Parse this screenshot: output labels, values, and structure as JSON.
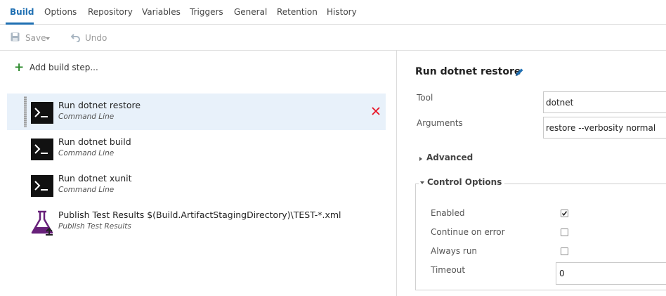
{
  "tabs": [
    {
      "label": "Build",
      "active": true
    },
    {
      "label": "Options"
    },
    {
      "label": "Repository"
    },
    {
      "label": "Variables"
    },
    {
      "label": "Triggers"
    },
    {
      "label": "General"
    },
    {
      "label": "Retention"
    },
    {
      "label": "History"
    }
  ],
  "toolbar": {
    "save_label": "Save",
    "undo_label": "Undo",
    "save_icon": "floppy-disk-icon",
    "undo_icon": "undo-arrow-icon"
  },
  "steps_panel": {
    "add_step_label": "Add build step...",
    "steps": [
      {
        "title": "Run dotnet restore",
        "subtitle": "Command Line",
        "icon": "command-line-icon",
        "selected": true
      },
      {
        "title": "Run dotnet build",
        "subtitle": "Command Line",
        "icon": "command-line-icon"
      },
      {
        "title": "Run dotnet xunit",
        "subtitle": "Command Line",
        "icon": "command-line-icon"
      },
      {
        "title": "Publish Test Results $(Build.ArtifactStagingDirectory)\\TEST-*.xml",
        "subtitle": "Publish Test Results",
        "icon": "flask-publish-icon"
      }
    ]
  },
  "details": {
    "title": "Run dotnet restore",
    "tool_label": "Tool",
    "tool_value": "dotnet",
    "arguments_label": "Arguments",
    "arguments_value": "restore --verbosity normal",
    "advanced_label": "Advanced",
    "control_options_label": "Control Options",
    "options": [
      {
        "label": "Enabled",
        "checked": true
      },
      {
        "label": "Continue on error",
        "checked": false
      },
      {
        "label": "Always run",
        "checked": false
      }
    ],
    "timeout_label": "Timeout",
    "timeout_value": "0"
  },
  "colors": {
    "accent": "#1f6fb2",
    "add_green": "#2e8b2e",
    "delete_red": "#e81123",
    "selected_row": "#e8f1fa",
    "flask_purple": "#68217a"
  }
}
